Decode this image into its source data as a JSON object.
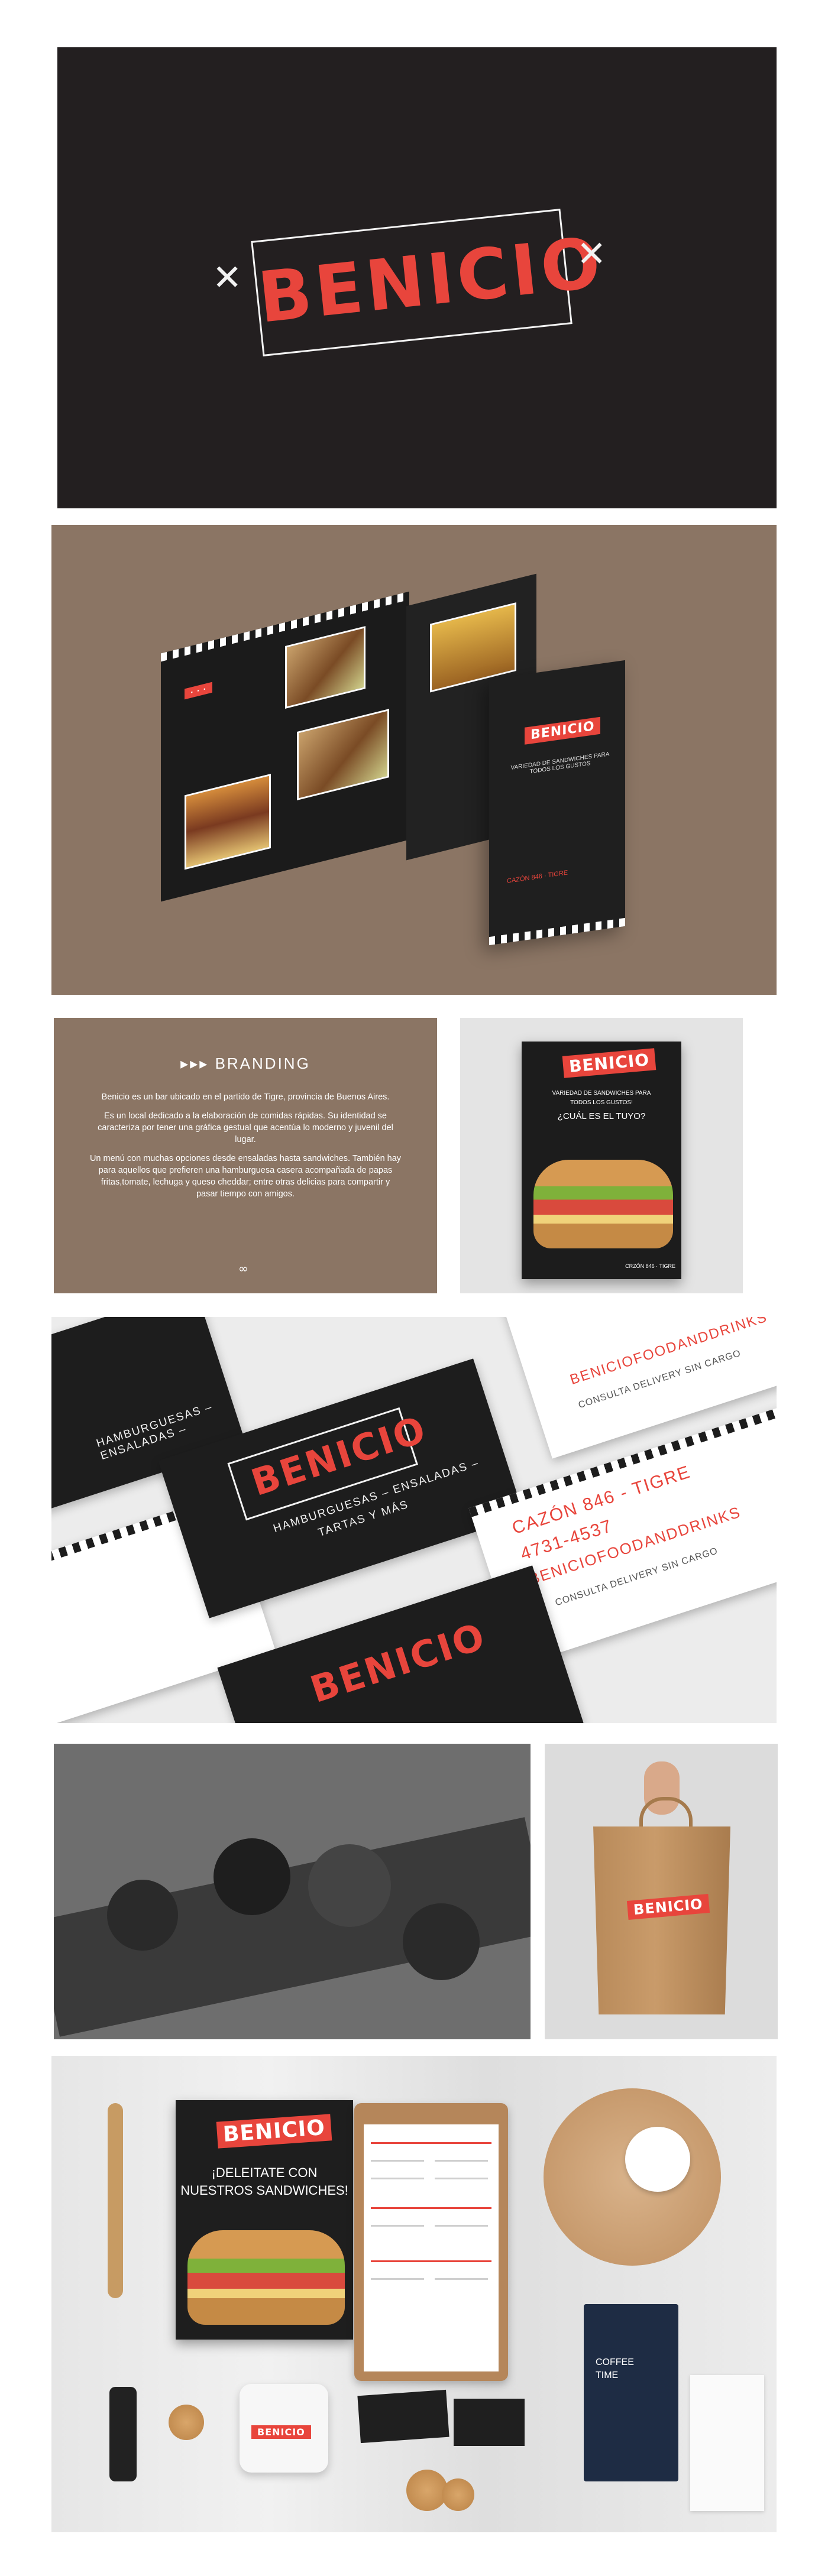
{
  "brand": {
    "name": "BENICIO",
    "accent_color": "#e8453c",
    "dark_color": "#231f20",
    "taupe_color": "#8b7564"
  },
  "branding": {
    "title": "BRANDING",
    "arrows": "▸▸▸",
    "paragraph_1": "Benicio es un bar ubicado en el partido de Tigre, provincia de Buenos Aires.",
    "paragraph_2": "Es un local dedicado a la elaboración de comidas rápidas. Su identidad se caracteriza por tener una gráfica gestual que acentúa lo moderno y juvenil del lugar.",
    "paragraph_3": "Un menú con muchas opciones desde ensaladas hasta sandwiches. También hay para aquellos que prefieren una hamburguesa casera acompañada de papas fritas,tomate, lechuga y queso cheddar; entre otras delicias para compartir y pasar tiempo con amigos."
  },
  "poster": {
    "logo": "BENICIO",
    "line_1": "VARIEDAD DE SANDWICHES PARA",
    "line_2": "TODOS LOS GUSTOS!",
    "question": "¿CUÁL ES EL TUYO?",
    "footer": "CRZÓN 846 · TIGRE"
  },
  "cards": {
    "logo": "BENICIO",
    "subtitle_1": "HAMBURGUESAS – ENSALADAS –",
    "subtitle_2": "TARTAS Y MÁS",
    "address": "CAZÓN 846 - TIGRE",
    "phone": "4731-4537",
    "social": "BENICIOFOODANDDRINKS",
    "delivery": "CONSULTA DELIVERY SIN CARGO"
  },
  "brochure": {
    "logo": "BENICIO",
    "cover_line": "VARIEDAD DE SANDWICHES PARA TODOS LOS GUSTOS",
    "footer": "CAZÓN 846 · TIGRE"
  },
  "bag": {
    "logo": "BENICIO"
  },
  "flatlay": {
    "book_logo": "BENICIO",
    "book_line_1": "¡DELEITATE CON",
    "book_line_2": "NUESTROS SANDWICHES!",
    "mug_logo": "BENICIO",
    "coffee_bag_line_1": "COFFEE",
    "coffee_bag_line_2": "TIME"
  }
}
